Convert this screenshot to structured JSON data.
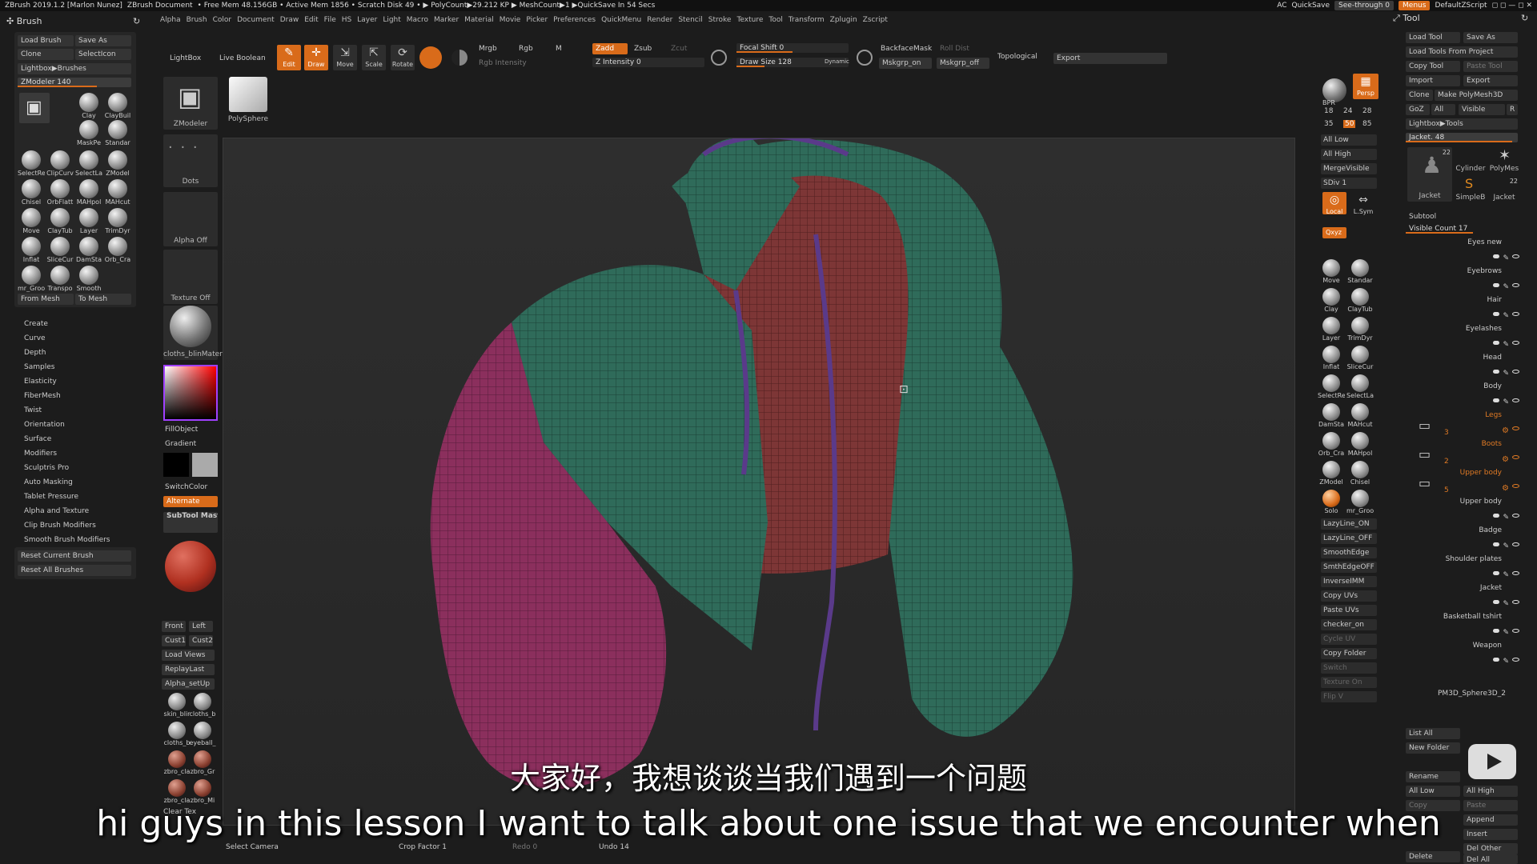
{
  "titlebar": {
    "app": "ZBrush 2019.1.2 [Marlon Nunez]",
    "doc": "ZBrush Document",
    "stats": "• Free Mem 48.156GB • Active Mem 1856 • Scratch Disk 49 • ▶ PolyCount▶29.212 KP ▶ MeshCount▶1 ▶QuickSave In 54 Secs",
    "ac": "AC",
    "quicksave": "QuickSave",
    "seethrough": "See-through  0",
    "menus": "Menus",
    "zscript": "DefaultZScript"
  },
  "menubar": [
    "Alpha",
    "Brush",
    "Color",
    "Document",
    "Draw",
    "Edit",
    "File",
    "HS",
    "Layer",
    "Light",
    "Macro",
    "Marker",
    "Material",
    "Movie",
    "Picker",
    "Preferences",
    "QuickMenu",
    "Render",
    "Stencil",
    "Stroke",
    "Texture",
    "Tool",
    "Transform",
    "Zplugin",
    "Zscript"
  ],
  "brush_panel": {
    "title": "Brush",
    "load": "Load Brush",
    "saveas": "Save As",
    "clone": "Clone",
    "selecticon": "SelectIcon",
    "lightbox": "Lightbox▶Brushes",
    "zmodeler": "ZModeler  140",
    "from_mesh": "From Mesh",
    "to_mesh": "To Mesh",
    "brushes": [
      "ZModeler",
      "Clay",
      "ClayBuil",
      "MaskPe",
      "Standar",
      "SelectRe",
      "ClipCurv",
      "SelectLa",
      "ZModel",
      "Chisel",
      "OrbFlatt",
      "MAHpol",
      "MAHcut",
      "Move",
      "ClayTub",
      "Layer",
      "TrimDyr",
      "Inflat",
      "SliceCur",
      "DamSta",
      "Orb_Cra",
      "mr_Groo",
      "Transpo",
      "Smooth"
    ],
    "sections": [
      "Create",
      "Curve",
      "Depth",
      "Samples",
      "Elasticity",
      "FiberMesh",
      "Twist",
      "Orientation",
      "Surface",
      "Modifiers",
      "Sculptris Pro",
      "Auto Masking",
      "Tablet Pressure",
      "Alpha and Texture",
      "Clip Brush Modifiers",
      "Smooth Brush Modifiers"
    ],
    "reset_current": "Reset Current Brush",
    "reset_all": "Reset All Brushes"
  },
  "shelf": {
    "lightbox": "LightBox",
    "liveboolean": "Live Boolean",
    "zmodeler": "ZModeler",
    "polysphere": "PolySphere",
    "dots": "Dots",
    "alpha_off": "Alpha Off",
    "texture_off": "Texture Off",
    "material": "cloths_blinMater",
    "fillobject": "FillObject",
    "gradient": "Gradient",
    "switchcolor": "SwitchColor",
    "alternate": "Alternate",
    "subtool_master": "SubTool Master",
    "views": [
      "Front",
      "Left",
      "Cust1",
      "Cust2"
    ],
    "load_views": "Load Views",
    "replay_last": "ReplayLast",
    "alpha_setup": "Alpha_setUp",
    "materials": [
      "skin_blir",
      "cloths_b",
      "cloths_b",
      "eyeball_",
      "zbro_cla",
      "zbro_Gr",
      "zbro_cla",
      "zbro_Mi"
    ],
    "clear_tex": "Clear Tex",
    "select_camera": "Select Camera"
  },
  "toolbar": {
    "edit": "Edit",
    "draw": "Draw",
    "move": "Move",
    "scale": "Scale",
    "rotate": "Rotate",
    "mrgb": "Mrgb",
    "rgb": "Rgb",
    "m": "M",
    "zadd": "Zadd",
    "zsub": "Zsub",
    "zcut": "Zcut",
    "rgb_intensity": "Rgb Intensity",
    "z_intensity": "Z Intensity 0",
    "focal_shift": "Focal Shift 0",
    "draw_size": "Draw Size 128",
    "dynamic": "Dynamic",
    "backfacemask": "BackfaceMask",
    "rolldist": "Roll Dist",
    "mskgrp_on": "Mskgrp_on",
    "mskgrp_off": "Mskgrp_off",
    "topological": "Topological",
    "export": "Export",
    "crop_factor": "Crop Factor 1",
    "undo": "Undo 14",
    "redo": "Redo 0"
  },
  "right_shelf": {
    "bpr": "BPR",
    "persp": "Persp",
    "sizes": [
      "18",
      "24",
      "28",
      "35",
      "50",
      "85"
    ],
    "all_low": "All Low",
    "all_high": "All High",
    "mergevisible": "MergeVisible",
    "sdiv": "SDiv 1",
    "local": "Local",
    "lsym": "L.Sym",
    "qxyz": "Qxyz",
    "brushes": [
      "Move",
      "Standar",
      "Clay",
      "ClayTub",
      "Layer",
      "TrimDyr",
      "Inflat",
      "SliceCur",
      "SelectRe",
      "SelectLa",
      "DamSta",
      "MAHcut",
      "Orb_Cra",
      "MAHpol",
      "ZModel",
      "Chisel",
      "Solo",
      "mr_Groo"
    ],
    "buttons": [
      "LazyLine_ON",
      "LazyLine_OFF",
      "SmoothEdge",
      "SmthEdgeOFF",
      "InverseIMM",
      "Copy UVs",
      "Paste UVs",
      "checker_on",
      "Cycle UV",
      "Copy Folder",
      "Switch",
      "Texture On",
      "Flip V"
    ]
  },
  "tool_panel": {
    "title": "Tool",
    "load_tool": "Load Tool",
    "save_as": "Save As",
    "load_from_project": "Load Tools From Project",
    "copy_tool": "Copy Tool",
    "paste_tool": "Paste Tool",
    "import": "Import",
    "export": "Export",
    "clone": "Clone",
    "make_polymesh": "Make PolyMesh3D",
    "goz": "GoZ",
    "all": "All",
    "visible": "Visible",
    "r": "R",
    "lightbox_tools": "Lightbox▶Tools",
    "jacket": "Jacket. 48",
    "thumbs": [
      "Jacket",
      "Cylinder",
      "PolyMes",
      "SimpleB",
      "Jacket"
    ],
    "thumb_count1": "22",
    "thumb_count2": "22",
    "subtool": "Subtool",
    "visible_count": "Visible Count 17",
    "subtools": [
      {
        "name": "Eyes new",
        "folder": false
      },
      {
        "name": "Eyebrows",
        "folder": false
      },
      {
        "name": "Hair",
        "folder": false
      },
      {
        "name": "Eyelashes",
        "folder": false
      },
      {
        "name": "Head",
        "folder": false
      },
      {
        "name": "Body",
        "folder": false
      },
      {
        "name": "Legs",
        "folder": true,
        "count": "3"
      },
      {
        "name": "Boots",
        "folder": true,
        "count": "2"
      },
      {
        "name": "Upper body",
        "folder": true,
        "count": "5"
      },
      {
        "name": "Upper body",
        "folder": false
      },
      {
        "name": "Badge",
        "folder": false
      },
      {
        "name": "Shoulder plates",
        "folder": false
      },
      {
        "name": "Jacket",
        "folder": false
      },
      {
        "name": "Basketball tshirt",
        "folder": false
      },
      {
        "name": "Weapon",
        "folder": false
      }
    ],
    "pm3d": "PM3D_Sphere3D_2",
    "list_all": "List All",
    "new_folder": "New Folder",
    "rename": "Rename",
    "all_low": "All Low",
    "all_high": "All High",
    "copy": "Copy",
    "paste": "Paste",
    "append": "Append",
    "insert": "Insert",
    "del_other": "Del Other",
    "delete": "Delete",
    "del_all": "Del All"
  },
  "subtitles": {
    "cn": "大家好，我想谈谈当我们遇到一个问题",
    "en": "hi guys in this lesson I want to talk about one issue that we encounter when"
  },
  "colors": {
    "accent": "#d96b1a",
    "jacket_green": "#2e6a5a",
    "sleeve_magenta": "#8a2f5c",
    "lining_red": "#8a3a3a"
  }
}
